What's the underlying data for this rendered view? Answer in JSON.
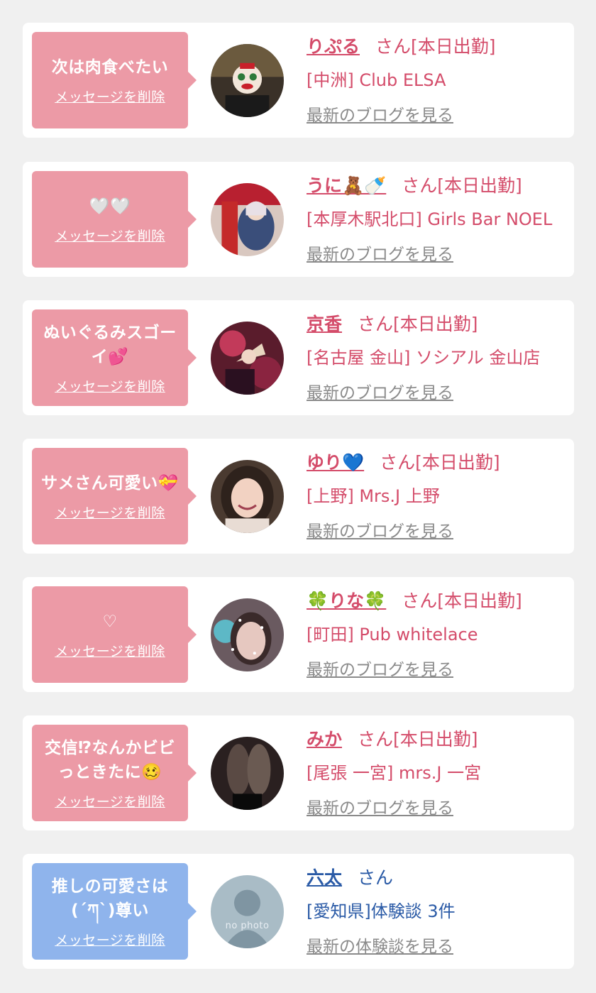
{
  "colors": {
    "bubble_pink": "#ec9aa6",
    "bubble_blue": "#8fb4ec",
    "name_pink": "#d44c6a",
    "name_blue": "#2a5aa6",
    "link_gray": "#8a8a8a",
    "background": "#f0f0f0"
  },
  "cards": [
    {
      "message": "次は肉食べたい",
      "delete_label": "メッセージを削除",
      "avatar_icon": "masked-costume-photo",
      "name": "りぷる",
      "suffix": "さん[本日出勤]",
      "shop": "[中洲] Club ELSA",
      "blog_label": "最新のブログを見る"
    },
    {
      "message": "🤍🤍",
      "delete_label": "メッセージを削除",
      "avatar_icon": "red-lantern-photo",
      "name": "うに🧸🍼",
      "suffix": "さん[本日出勤]",
      "shop": "[本厚木駅北口] Girls Bar NOEL",
      "blog_label": "最新のブログを見る"
    },
    {
      "message": "ぬいぐるみスゴーイ💕",
      "delete_label": "メッセージを削除",
      "avatar_icon": "kimono-fan-photo",
      "name": "京香",
      "suffix": "さん[本日出勤]",
      "shop": "[名古屋 金山] ソシアル 金山店",
      "blog_label": "最新のブログを見る"
    },
    {
      "message": "サメさん可愛い💝",
      "delete_label": "メッセージを削除",
      "avatar_icon": "smiling-woman-photo",
      "name": "ゆり💙",
      "suffix": "さん[本日出勤]",
      "shop": "[上野] Mrs.J 上野",
      "blog_label": "最新のブログを見る"
    },
    {
      "message": "♡",
      "delete_label": "メッセージを削除",
      "avatar_icon": "sparkle-filter-photo",
      "name": "🍀りな🍀",
      "suffix": "さん[本日出勤]",
      "shop": "[町田] Pub whitelace",
      "blog_label": "最新のブログを見る"
    },
    {
      "message": "交信⁉なんかビビっときたに🥴",
      "delete_label": "メッセージを削除",
      "avatar_icon": "legs-photo",
      "name": "みか",
      "suffix": "さん[本日出勤]",
      "shop": "[尾張 一宮] mrs.J 一宮",
      "blog_label": "最新のブログを見る"
    },
    {
      "message": "推しの可愛さは(´ཀ`)尊い",
      "delete_label": "メッセージを削除",
      "avatar_icon": "no-photo-silhouette",
      "avatar_text": "no photo",
      "name": "六太",
      "suffix": "さん",
      "shop": "[愛知県]体験談 3件",
      "blog_label": "最新の体験談を見る"
    }
  ]
}
